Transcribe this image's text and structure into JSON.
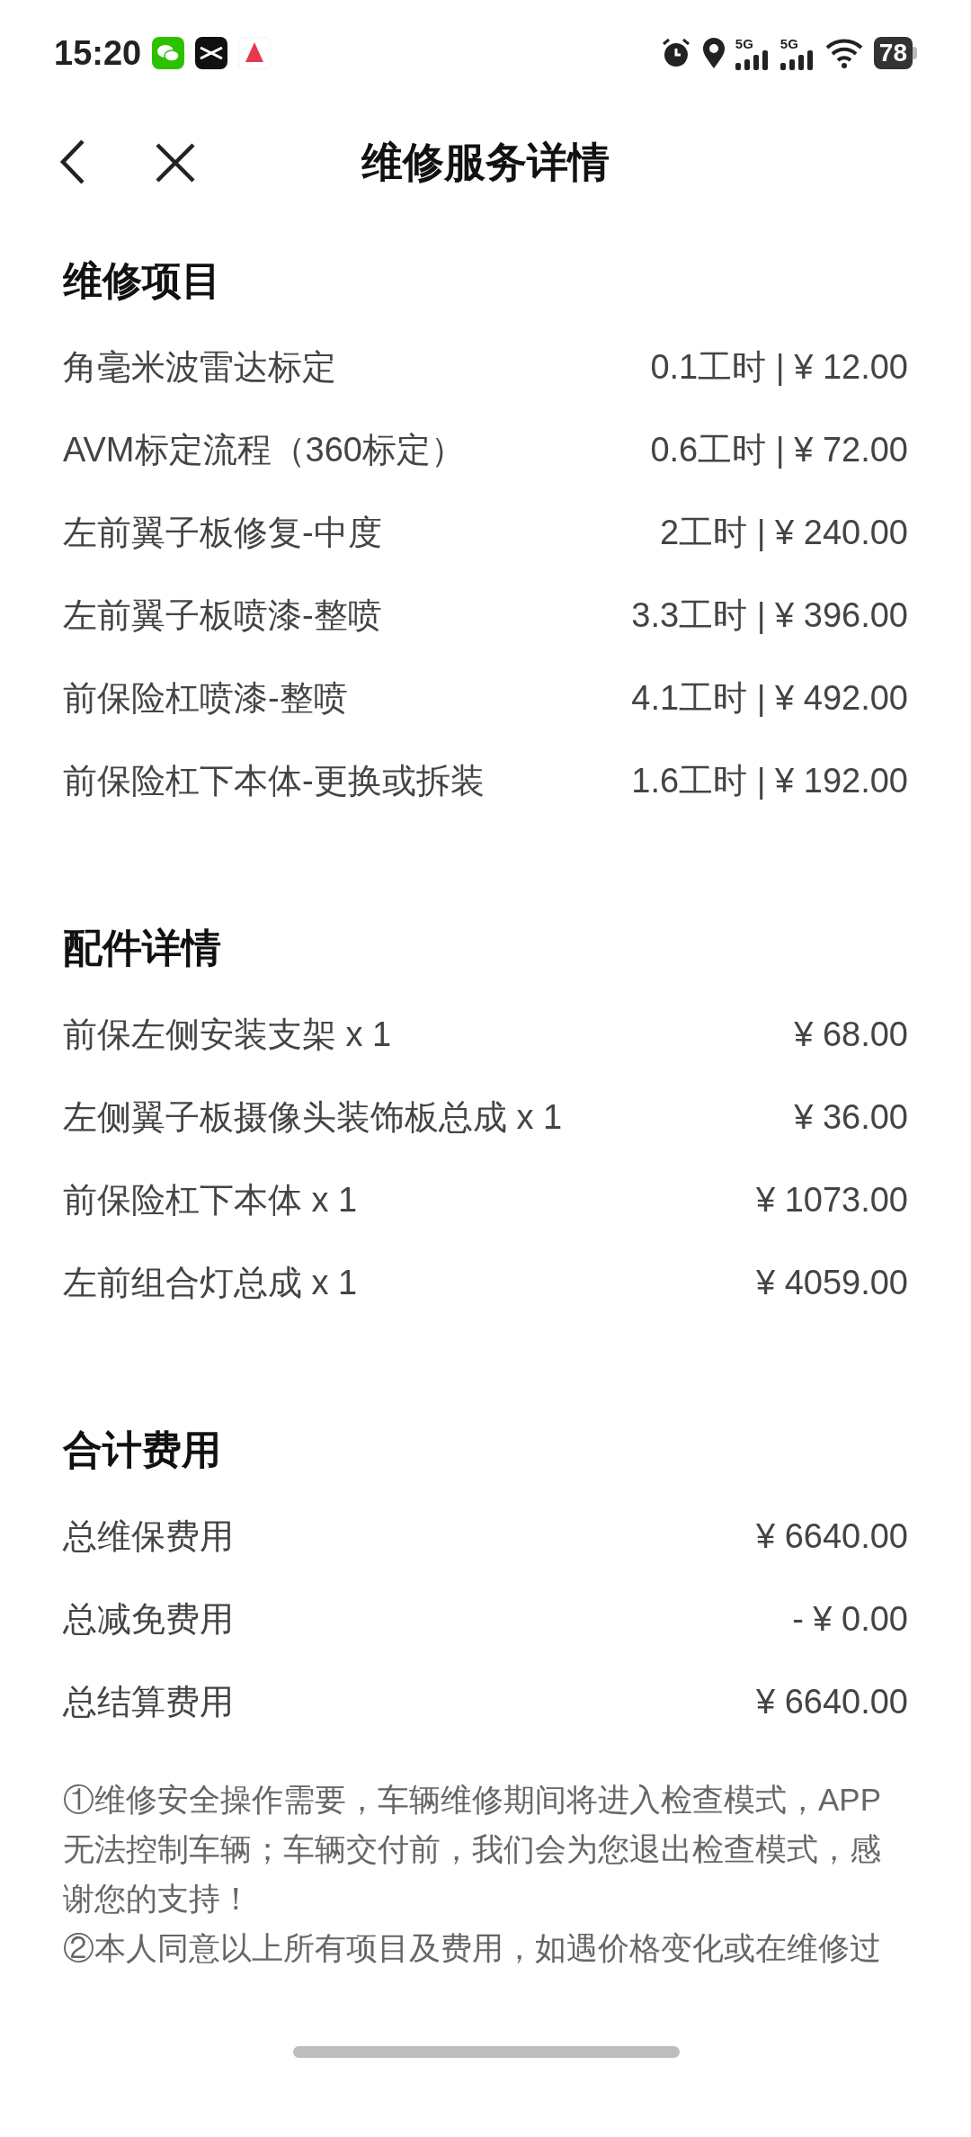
{
  "status_bar": {
    "time": "15:20",
    "network_1": "5G",
    "network_2": "5G",
    "battery": "78"
  },
  "header": {
    "title": "维修服务详情"
  },
  "sections": [
    {
      "title": "维修项目",
      "rows": [
        {
          "name": "角毫米波雷达标定",
          "value": "0.1工时 | ¥ 12.00"
        },
        {
          "name": "AVM标定流程（360标定）",
          "value": "0.6工时 | ¥ 72.00"
        },
        {
          "name": "左前翼子板修复-中度",
          "value": "2工时 | ¥ 240.00"
        },
        {
          "name": "左前翼子板喷漆-整喷",
          "value": "3.3工时 | ¥ 396.00"
        },
        {
          "name": "前保险杠喷漆-整喷",
          "value": "4.1工时 | ¥ 492.00"
        },
        {
          "name": "前保险杠下本体-更换或拆装",
          "value": "1.6工时 | ¥ 192.00"
        }
      ]
    },
    {
      "title": "配件详情",
      "rows": [
        {
          "name": "前保左侧安装支架 x 1",
          "value": "¥ 68.00"
        },
        {
          "name": "左侧翼子板摄像头装饰板总成 x 1",
          "value": "¥ 36.00"
        },
        {
          "name": "前保险杠下本体 x 1",
          "value": "¥ 1073.00"
        },
        {
          "name": "左前组合灯总成 x 1",
          "value": "¥ 4059.00"
        }
      ]
    },
    {
      "title": "合计费用",
      "rows": [
        {
          "name": "总维保费用",
          "value": "¥ 6640.00"
        },
        {
          "name": "总减免费用",
          "value": "- ¥ 0.00"
        },
        {
          "name": "总结算费用",
          "value": "¥ 6640.00"
        }
      ]
    }
  ],
  "notes": [
    "①维修安全操作需要，车辆维修期间将进入检查模式，APP无法控制车辆；车辆交付前，我们会为您退出检查模式，感谢您的支持！",
    "②本人同意以上所有项目及费用，如遇价格变化或在维修过"
  ]
}
